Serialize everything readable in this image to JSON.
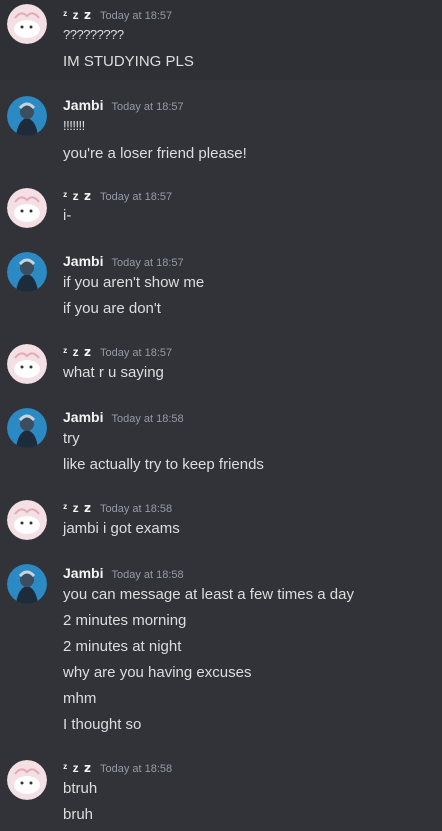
{
  "users": {
    "zz": {
      "name": "ᶻ z 𝘇"
    },
    "jambi": {
      "name": "Jambi"
    }
  },
  "messages": [
    {
      "author": "zz",
      "timestamp": "Today at 18:57",
      "lines": [
        "?????????",
        "IM STUDYING PLS"
      ]
    },
    {
      "author": "jambi",
      "timestamp": "Today at 18:57",
      "lines": [
        "!!!!!!!",
        "you're a loser friend please!"
      ]
    },
    {
      "author": "zz",
      "timestamp": "Today at 18:57",
      "lines": [
        "i-"
      ]
    },
    {
      "author": "jambi",
      "timestamp": "Today at 18:57",
      "lines": [
        "if you aren't show me",
        "if you are don't"
      ]
    },
    {
      "author": "zz",
      "timestamp": "Today at 18:57",
      "lines": [
        "what r u saying"
      ]
    },
    {
      "author": "jambi",
      "timestamp": "Today at 18:58",
      "lines": [
        "try",
        "like actually try to keep friends"
      ]
    },
    {
      "author": "zz",
      "timestamp": "Today at 18:58",
      "lines": [
        "jambi i got exams"
      ]
    },
    {
      "author": "jambi",
      "timestamp": "Today at 18:58",
      "lines": [
        "you can message at least a few times a day",
        "2 minutes morning",
        "2 minutes at night",
        "why are you having excuses",
        "mhm",
        "I thought so"
      ]
    },
    {
      "author": "zz",
      "timestamp": "Today at 18:58",
      "lines": [
        "btruh",
        "bruh"
      ]
    }
  ]
}
